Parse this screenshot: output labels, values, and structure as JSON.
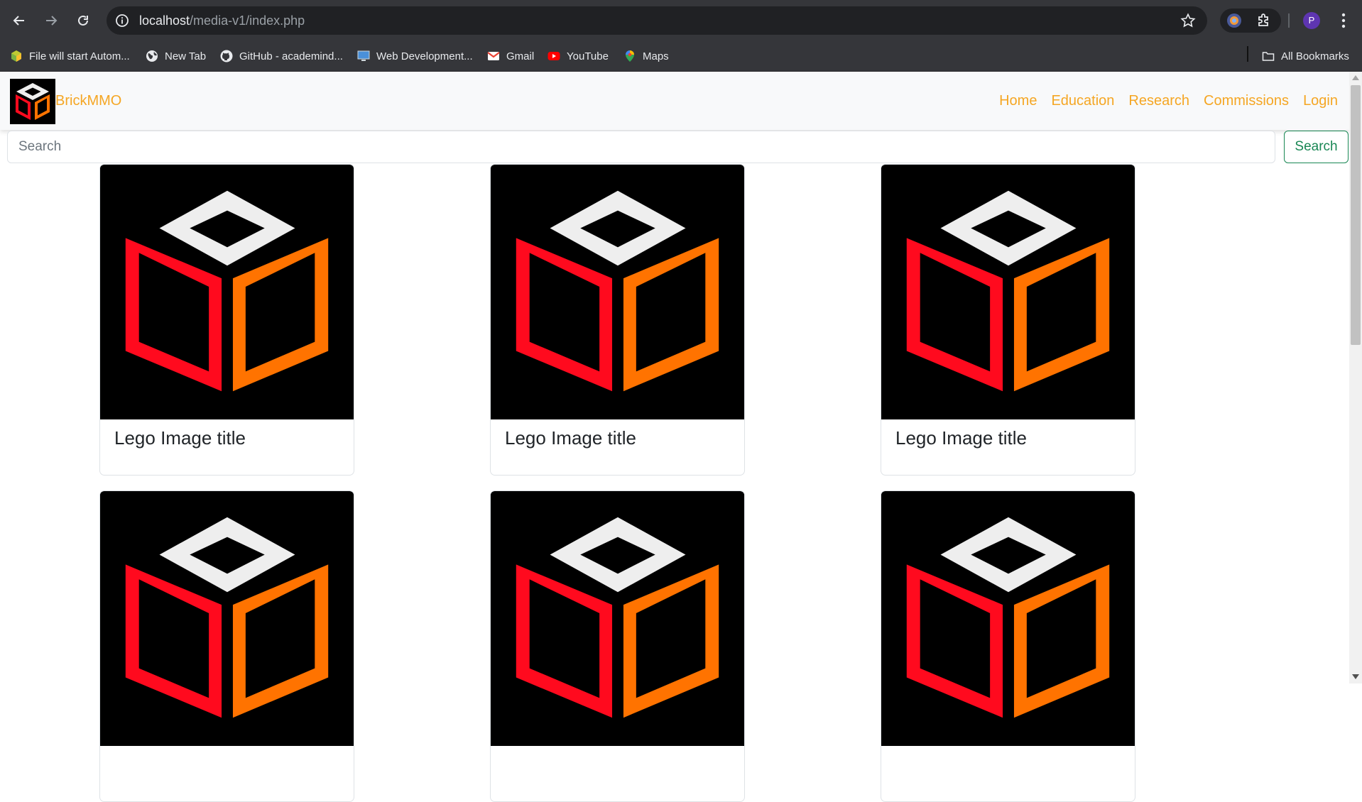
{
  "browser": {
    "url_host": "localhost",
    "url_path": "/media-v1/index.php",
    "avatar_letter": "P",
    "bookmarks": [
      {
        "label": "File will start Autom...",
        "icon": "cube-icon"
      },
      {
        "label": "New Tab",
        "icon": "globe-icon"
      },
      {
        "label": "GitHub - academind...",
        "icon": "github-icon"
      },
      {
        "label": "Web Development...",
        "icon": "monitor-icon"
      },
      {
        "label": "Gmail",
        "icon": "gmail-icon"
      },
      {
        "label": "YouTube",
        "icon": "youtube-icon"
      },
      {
        "label": "Maps",
        "icon": "maps-pin-icon"
      }
    ],
    "all_bookmarks": "All Bookmarks"
  },
  "navbar": {
    "brand": "BrickMMO",
    "links": [
      "Home",
      "Education",
      "Research",
      "Commissions",
      "Login"
    ]
  },
  "search": {
    "placeholder": "Search",
    "button_label": "Search"
  },
  "cards": [
    {
      "title": "Lego Image title"
    },
    {
      "title": "Lego Image title"
    },
    {
      "title": "Lego Image title"
    },
    {
      "title": ""
    },
    {
      "title": ""
    },
    {
      "title": ""
    }
  ],
  "colors": {
    "brand_accent": "#f5a623",
    "search_button": "#198754",
    "cube_top": "#eeeeee",
    "cube_left": "#ff0a1e",
    "cube_right": "#ff7300"
  }
}
